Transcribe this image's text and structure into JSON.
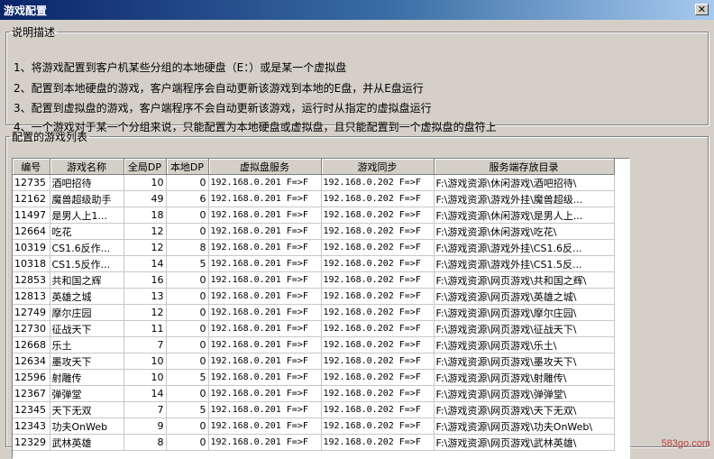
{
  "window": {
    "title": "游戏配置",
    "close_glyph": "✕"
  },
  "description": {
    "legend": "说明描述",
    "lines": [
      "1、将游戏配置到客户机某些分组的本地硬盘（E：）或是某一个虚拟盘",
      "2、配置到本地硬盘的游戏，客户端程序会自动更新该游戏到本地的E盘，并从E盘运行",
      "3、配置到虚拟盘的游戏，客户端程序不会自动更新该游戏，运行时从指定的虚拟盘运行",
      "4、一个游戏对于某一个分组来说，只能配置为本地硬盘或虚拟盘，且只能配置到一个虚拟盘的盘符上"
    ]
  },
  "game_list": {
    "legend": "配置的游戏列表",
    "columns": [
      "编号",
      "游戏名称",
      "全局DP",
      "本地DP",
      "虚拟盘服务",
      "游戏同步",
      "服务端存放目录"
    ],
    "rows": [
      [
        "12735",
        "酒吧招待",
        "10",
        "0",
        "192.168.0.201 F=>F",
        "192.168.0.202 F=>F",
        "F:\\游戏资源\\休闲游戏\\酒吧招待\\"
      ],
      [
        "12162",
        "魔兽超级助手",
        "49",
        "6",
        "192.168.0.201 F=>F",
        "192.168.0.202 F=>F",
        "F:\\游戏资源\\游戏外挂\\魔兽超级..."
      ],
      [
        "11497",
        "是男人上1...",
        "18",
        "0",
        "192.168.0.201 F=>F",
        "192.168.0.202 F=>F",
        "F:\\游戏资源\\休闲游戏\\是男人上..."
      ],
      [
        "12664",
        "吃花",
        "12",
        "0",
        "192.168.0.201 F=>F",
        "192.168.0.202 F=>F",
        "F:\\游戏资源\\休闲游戏\\吃花\\"
      ],
      [
        "10319",
        "CS1.6反作...",
        "12",
        "8",
        "192.168.0.201 F=>F",
        "192.168.0.202 F=>F",
        "F:\\游戏资源\\游戏外挂\\CS1.6反..."
      ],
      [
        "10318",
        "CS1.5反作...",
        "14",
        "5",
        "192.168.0.201 F=>F",
        "192.168.0.202 F=>F",
        "F:\\游戏资源\\游戏外挂\\CS1.5反..."
      ],
      [
        "12853",
        "共和国之辉",
        "16",
        "0",
        "192.168.0.201 F=>F",
        "192.168.0.202 F=>F",
        "F:\\游戏资源\\网页游戏\\共和国之辉\\"
      ],
      [
        "12813",
        "英雄之城",
        "13",
        "0",
        "192.168.0.201 F=>F",
        "192.168.0.202 F=>F",
        "F:\\游戏资源\\网页游戏\\英雄之城\\"
      ],
      [
        "12749",
        "摩尔庄园",
        "12",
        "0",
        "192.168.0.201 F=>F",
        "192.168.0.202 F=>F",
        "F:\\游戏资源\\网页游戏\\摩尔庄园\\"
      ],
      [
        "12730",
        "征战天下",
        "11",
        "0",
        "192.168.0.201 F=>F",
        "192.168.0.202 F=>F",
        "F:\\游戏资源\\网页游戏\\征战天下\\"
      ],
      [
        "12668",
        "乐土",
        "7",
        "0",
        "192.168.0.201 F=>F",
        "192.168.0.202 F=>F",
        "F:\\游戏资源\\网页游戏\\乐土\\"
      ],
      [
        "12634",
        "墨攻天下",
        "10",
        "0",
        "192.168.0.201 F=>F",
        "192.168.0.202 F=>F",
        "F:\\游戏资源\\网页游戏\\墨攻天下\\"
      ],
      [
        "12596",
        "射雕传",
        "10",
        "5",
        "192.168.0.201 F=>F",
        "192.168.0.202 F=>F",
        "F:\\游戏资源\\网页游戏\\射雕传\\"
      ],
      [
        "12367",
        "弹弹堂",
        "14",
        "0",
        "192.168.0.201 F=>F",
        "192.168.0.202 F=>F",
        "F:\\游戏资源\\网页游戏\\弹弹堂\\"
      ],
      [
        "12345",
        "天下无双",
        "7",
        "5",
        "192.168.0.201 F=>F",
        "192.168.0.202 F=>F",
        "F:\\游戏资源\\网页游戏\\天下无双\\"
      ],
      [
        "12343",
        "功夫OnWeb",
        "9",
        "0",
        "192.168.0.201 F=>F",
        "192.168.0.202 F=>F",
        "F:\\游戏资源\\网页游戏\\功夫OnWeb\\"
      ],
      [
        "12329",
        "武林英雄",
        "8",
        "0",
        "192.168.0.201 F=>F",
        "192.168.0.202 F=>F",
        "F:\\游戏资源\\网页游戏\\武林英雄\\"
      ]
    ]
  },
  "watermark": "583go.com"
}
